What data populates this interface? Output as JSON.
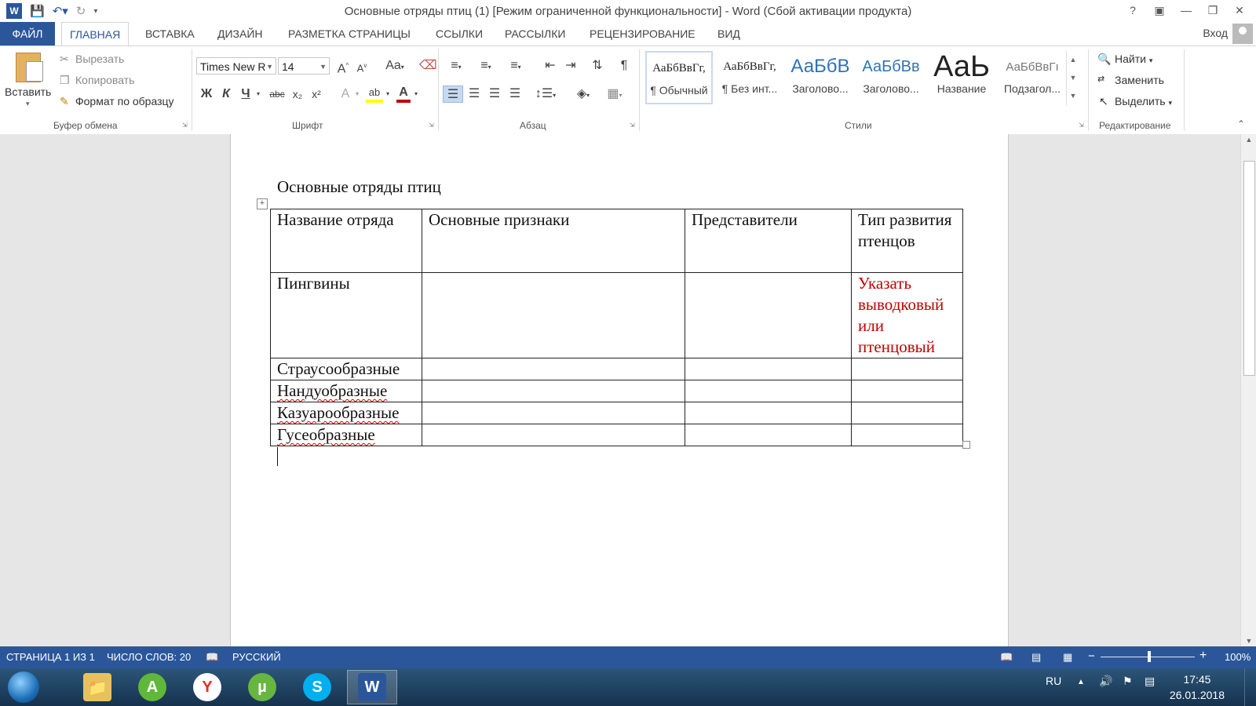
{
  "window": {
    "title": "Основные отряды птиц (1) [Режим ограниченной функциональности] - Word (Сбой активации продукта)",
    "logo": "W",
    "help": "?",
    "controls": [
      "▣",
      "—",
      "❐",
      "✕"
    ]
  },
  "tabs": [
    "ФАЙЛ",
    "ГЛАВНАЯ",
    "ВСТАВКА",
    "ДИЗАЙН",
    "РАЗМЕТКА СТРАНИЦЫ",
    "ССЫЛКИ",
    "РАССЫЛКИ",
    "РЕЦЕНЗИРОВАНИЕ",
    "ВИД"
  ],
  "account": {
    "login": "Вход"
  },
  "ribbon": {
    "clipboard": {
      "paste": "Вставить",
      "cut": "Вырезать",
      "copy": "Копировать",
      "format_painter": "Формат по образцу",
      "label": "Буфер обмена"
    },
    "font": {
      "name": "Times New R",
      "size": "14",
      "label": "Шрифт",
      "bold": "Ж",
      "italic": "К",
      "underline": "Ч",
      "strike": "abc",
      "subscript": "x₂",
      "superscript": "x²",
      "grow": "A",
      "shrink": "A",
      "case": "Aa",
      "effects": "A",
      "highlight": "ab",
      "color": "A",
      "font_color_hex": "#c00000",
      "highlight_hex": "#ffff00"
    },
    "paragraph": {
      "label": "Абзац",
      "pilcrow": "¶"
    },
    "styles": {
      "label": "Стили",
      "items": [
        {
          "sample": "АаБбВвГг,",
          "name": "¶ Обычный"
        },
        {
          "sample": "АаБбВвГг,",
          "name": "¶ Без инт..."
        },
        {
          "sample": "АаБбВ",
          "name": "Заголово..."
        },
        {
          "sample": "АаБбВв",
          "name": "Заголово..."
        },
        {
          "sample": "АаЬ",
          "name": "Название"
        },
        {
          "sample": "АаБбВвГı",
          "name": "Подзагол..."
        }
      ]
    },
    "editing": {
      "label": "Редактирование",
      "find": "Найти",
      "replace": "Заменить",
      "select": "Выделить"
    }
  },
  "document": {
    "title": "Основные отряды птиц",
    "table": {
      "headers": [
        "Название отряда",
        "Основные признаки",
        "Представители",
        "Тип развития птенцов"
      ],
      "rows": [
        [
          "Пингвины",
          "",
          "",
          "Указать выводковый или птенцовый"
        ],
        [
          "Страусообразные",
          "",
          "",
          ""
        ],
        [
          "Нандуобразные",
          "",
          "",
          ""
        ],
        [
          "Казуарообразные",
          "",
          "",
          ""
        ],
        [
          "Гусеобразные",
          "",
          "",
          ""
        ]
      ]
    },
    "accent_red": "#c00000"
  },
  "status": {
    "page": "СТРАНИЦА 1 ИЗ 1",
    "words": "ЧИСЛО СЛОВ: 20",
    "language": "РУССКИЙ",
    "zoom": "100%",
    "zoom_minus": "−",
    "zoom_plus": "+"
  },
  "taskbar": {
    "apps": [
      "explorer-icon",
      "aimp-icon",
      "yandex-icon",
      "utorrent-icon",
      "skype-icon",
      "word-icon"
    ],
    "lang": "RU",
    "time": "17:45",
    "date": "26.01.2018"
  }
}
